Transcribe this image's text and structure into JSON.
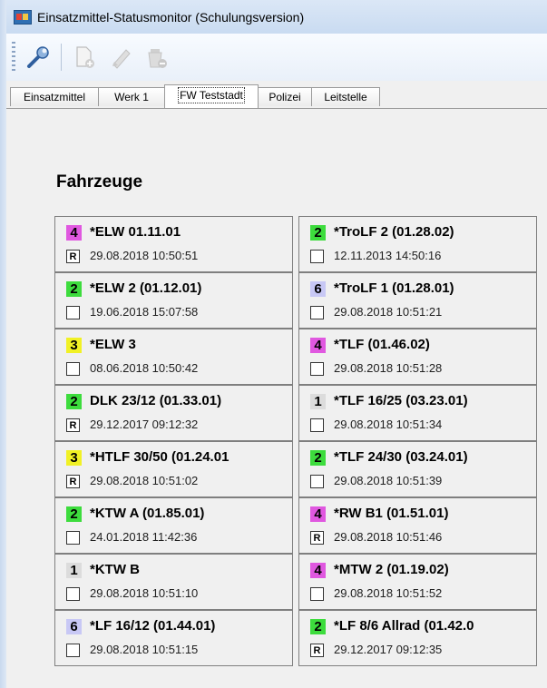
{
  "window": {
    "title": "Einsatzmittel-Statusmonitor (Schulungsversion)"
  },
  "toolbar": {
    "tools": [
      {
        "icon": "wrench-icon",
        "enabled": true
      },
      {
        "icon": "new-document-icon",
        "enabled": false
      },
      {
        "icon": "edit-pen-icon",
        "enabled": false
      },
      {
        "icon": "delete-bucket-icon",
        "enabled": false
      }
    ]
  },
  "tabs": [
    {
      "label": "Einsatzmittel",
      "active": false
    },
    {
      "label": "Werk 1",
      "active": false
    },
    {
      "label": "FW Teststadt",
      "active": true
    },
    {
      "label": "Polizei",
      "active": false
    },
    {
      "label": "Leitstelle",
      "active": false
    }
  ],
  "section": {
    "title": "Fahrzeuge"
  },
  "status_colors": {
    "1": "#dcdcdc",
    "2": "#3ddc3d",
    "3": "#f1f125",
    "4": "#e058e0",
    "6": "#c8c8f5"
  },
  "vehicles": [
    {
      "status": "4",
      "name": "*ELW 01.11.01",
      "flag": "R",
      "timestamp": "29.08.2018 10:50:51"
    },
    {
      "status": "2",
      "name": "*TroLF 2  (01.28.02)",
      "flag": "",
      "timestamp": "12.11.2013 14:50:16"
    },
    {
      "status": "2",
      "name": "*ELW 2 (01.12.01)",
      "flag": "",
      "timestamp": "19.06.2018 15:07:58"
    },
    {
      "status": "6",
      "name": "*TroLF 1  (01.28.01)",
      "flag": "",
      "timestamp": "29.08.2018 10:51:21"
    },
    {
      "status": "3",
      "name": "*ELW 3",
      "flag": "",
      "timestamp": "08.06.2018 10:50:42"
    },
    {
      "status": "4",
      "name": "*TLF (01.46.02)",
      "flag": "",
      "timestamp": "29.08.2018 10:51:28"
    },
    {
      "status": "2",
      "name": "DLK 23/12  (01.33.01)",
      "flag": "R",
      "timestamp": "29.12.2017 09:12:32"
    },
    {
      "status": "1",
      "name": "*TLF 16/25  (03.23.01)",
      "flag": "",
      "timestamp": "29.08.2018 10:51:34"
    },
    {
      "status": "3",
      "name": "*HTLF 30/50  (01.24.01",
      "flag": "R",
      "timestamp": "29.08.2018 10:51:02"
    },
    {
      "status": "2",
      "name": "*TLF 24/30  (03.24.01)",
      "flag": "",
      "timestamp": "29.08.2018 10:51:39"
    },
    {
      "status": "2",
      "name": "*KTW A  (01.85.01)",
      "flag": "",
      "timestamp": "24.01.2018 11:42:36"
    },
    {
      "status": "4",
      "name": "*RW B1 (01.51.01)",
      "flag": "R",
      "timestamp": "29.08.2018 10:51:46"
    },
    {
      "status": "1",
      "name": "*KTW B",
      "flag": "",
      "timestamp": "29.08.2018 10:51:10"
    },
    {
      "status": "4",
      "name": "*MTW 2  (01.19.02)",
      "flag": "",
      "timestamp": "29.08.2018 10:51:52"
    },
    {
      "status": "6",
      "name": "*LF 16/12 (01.44.01)",
      "flag": "",
      "timestamp": "29.08.2018 10:51:15"
    },
    {
      "status": "2",
      "name": "*LF 8/6 Allrad (01.42.0",
      "flag": "R",
      "timestamp": "29.12.2017 09:12:35"
    }
  ]
}
